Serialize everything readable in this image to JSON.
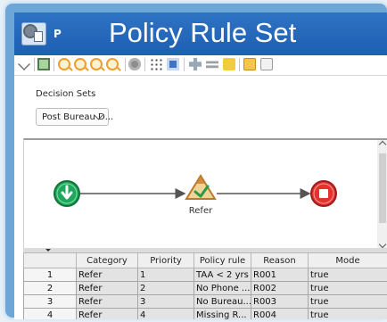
{
  "window": {
    "title_mark": "P",
    "title": "Policy Rule Set"
  },
  "toolbar": {
    "buttons": [
      {
        "name": "scissors-icon"
      },
      {
        "name": "preview-icon"
      },
      {
        "name": "zoom-in-icon"
      },
      {
        "name": "zoom-out-icon"
      },
      {
        "name": "zoom-fit-icon"
      },
      {
        "name": "zoom-reset-icon"
      },
      {
        "name": "stop-icon"
      },
      {
        "name": "grid-icon"
      },
      {
        "name": "select-frame-icon"
      },
      {
        "name": "node-icon"
      },
      {
        "name": "layout-icon"
      },
      {
        "name": "gauge-icon"
      },
      {
        "name": "note-icon"
      },
      {
        "name": "note-gray-icon"
      }
    ]
  },
  "decision_sets": {
    "label": "Decision Sets",
    "selected": "Post Bureau D..."
  },
  "flow": {
    "nodes": [
      {
        "id": "start",
        "label": "",
        "color": "#1ea85d"
      },
      {
        "id": "refer",
        "label": "Refer",
        "color": "#d9a34a"
      },
      {
        "id": "end",
        "label": "",
        "color": "#e6312f"
      }
    ]
  },
  "table": {
    "headers": [
      "",
      "Category",
      "Priority",
      "Policy rule",
      "Reason",
      "Mode"
    ],
    "rows": [
      [
        "1",
        "Refer",
        "1",
        "TAA < 2 yrs",
        "R001",
        "true"
      ],
      [
        "2",
        "Refer",
        "2",
        "No Phone ...",
        "R002",
        "true"
      ],
      [
        "3",
        "Refer",
        "3",
        "No Bureau...",
        "R003",
        "true"
      ],
      [
        "4",
        "Refer",
        "4",
        "Missing R...",
        "R004",
        "true"
      ]
    ]
  }
}
